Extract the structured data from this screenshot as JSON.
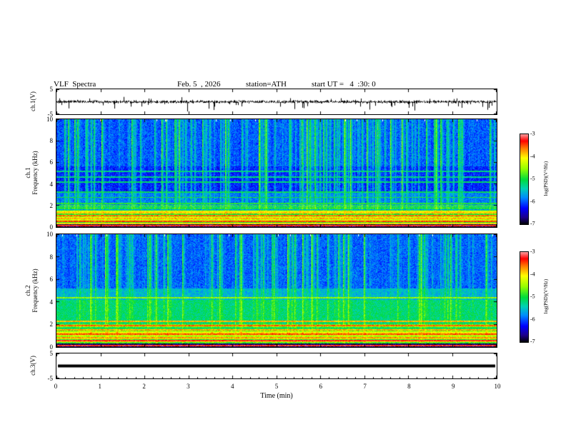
{
  "header": {
    "title": "VLF  Spectra",
    "date": "Feb. 5  , 2026",
    "station": "station=ATH",
    "start_ut": "start UT =   4  :30: 0"
  },
  "xaxis": {
    "label": "Time (min)",
    "xlim": [
      0,
      10
    ],
    "ticks": [
      0,
      1,
      2,
      3,
      4,
      5,
      6,
      7,
      8,
      9,
      10
    ]
  },
  "colorbar": {
    "label": "log(PSD)(V²/Hz)",
    "ticks": [
      -3,
      -4,
      -5,
      -6,
      -7
    ],
    "range": [
      -7,
      -3
    ]
  },
  "chart_data": [
    {
      "type": "line",
      "name": "ch1_waveform",
      "ylabel": "ch.1(V)",
      "ylim": [
        -5,
        5
      ],
      "yticks": [
        5,
        -5
      ],
      "seed": 101,
      "noise_amp": 0.7,
      "spike_rate": 0.05,
      "description": "broadband noise around 0 V with frequent negative impulse spikes"
    },
    {
      "type": "heatmap",
      "name": "ch1_spectrogram",
      "ylabel_lines": [
        "ch.1",
        "Frequency (kHz)"
      ],
      "ylim": [
        0,
        10
      ],
      "yticks": [
        0,
        2,
        4,
        6,
        8,
        10
      ],
      "seed": 202,
      "bands": [
        {
          "f": [
            5.6,
            10.0
          ],
          "base": 0.23,
          "stripe": 0.4
        },
        {
          "f": [
            3.2,
            5.6
          ],
          "base": 0.18,
          "stripe": 0.42
        },
        {
          "f": [
            2.05,
            3.2
          ],
          "base": 0.27,
          "stripe": 0.3
        },
        {
          "f": [
            1.5,
            2.05
          ],
          "base": 0.42,
          "stripe": 0.15,
          "banded": true
        },
        {
          "f": [
            0.3,
            1.5
          ],
          "base": 0.6,
          "stripe": 0.08,
          "banded": true
        },
        {
          "f": [
            0.0,
            0.3
          ],
          "base": 0.05,
          "stripe": 0.0
        }
      ],
      "hlines": [
        {
          "f": 2.2,
          "t": 0.52
        },
        {
          "f": 2.75,
          "t": 0.5
        },
        {
          "f": 3.25,
          "t": 0.48
        },
        {
          "f": 4.15,
          "t": 0.46
        },
        {
          "f": 4.65,
          "t": 0.44
        },
        {
          "f": 5.15,
          "t": 0.44
        },
        {
          "f": 1.3,
          "t": 0.78
        },
        {
          "f": 1.05,
          "t": 0.85
        },
        {
          "f": 0.8,
          "t": 0.8
        },
        {
          "f": 0.55,
          "t": 0.88
        },
        {
          "f": 0.35,
          "t": 0.75
        },
        {
          "f": 0.12,
          "t": 0.93
        }
      ],
      "description": "VLF spectrogram: dark-blue background above 2 kHz with dense vertical sferic stripes, cyan horizontal lines 2-5 kHz, yellow/red power-line bands below 1.5 kHz, near-black band at 0 kHz"
    },
    {
      "type": "heatmap",
      "name": "ch2_spectrogram",
      "ylabel_lines": [
        "ch.2",
        "Frequency (kHz)"
      ],
      "ylim": [
        0,
        10
      ],
      "yticks": [
        0,
        2,
        4,
        6,
        8,
        10
      ],
      "seed": 303,
      "bands": [
        {
          "f": [
            5.2,
            10.0
          ],
          "base": 0.24,
          "stripe": 0.38
        },
        {
          "f": [
            4.2,
            5.2
          ],
          "base": 0.34,
          "stripe": 0.28
        },
        {
          "f": [
            2.0,
            4.2
          ],
          "base": 0.44,
          "stripe": 0.2
        },
        {
          "f": [
            0.3,
            2.0
          ],
          "base": 0.58,
          "stripe": 0.1,
          "banded": true
        },
        {
          "f": [
            0.0,
            0.3
          ],
          "base": 0.06,
          "stripe": 0.0
        }
      ],
      "hlines": [
        {
          "f": 4.35,
          "t": 0.62
        },
        {
          "f": 2.3,
          "t": 0.8
        },
        {
          "f": 1.9,
          "t": 0.86
        },
        {
          "f": 1.5,
          "t": 0.8
        },
        {
          "f": 1.15,
          "t": 0.88
        },
        {
          "f": 0.85,
          "t": 0.82
        },
        {
          "f": 0.55,
          "t": 0.92
        },
        {
          "f": 0.15,
          "t": 0.94
        }
      ],
      "description": "VLF spectrogram: blue above 5 kHz with vertical stripes, green 2-5 kHz, yellow/green with red harmonic lines below 2 kHz, near-black band at 0 kHz"
    },
    {
      "type": "line",
      "name": "ch3_waveform",
      "ylabel": "ch.3(V)",
      "ylim": [
        -5,
        5
      ],
      "yticks": [
        5,
        -5
      ],
      "constant": 0,
      "thick": true,
      "description": "flat heavy black trace at ~0 V"
    }
  ]
}
